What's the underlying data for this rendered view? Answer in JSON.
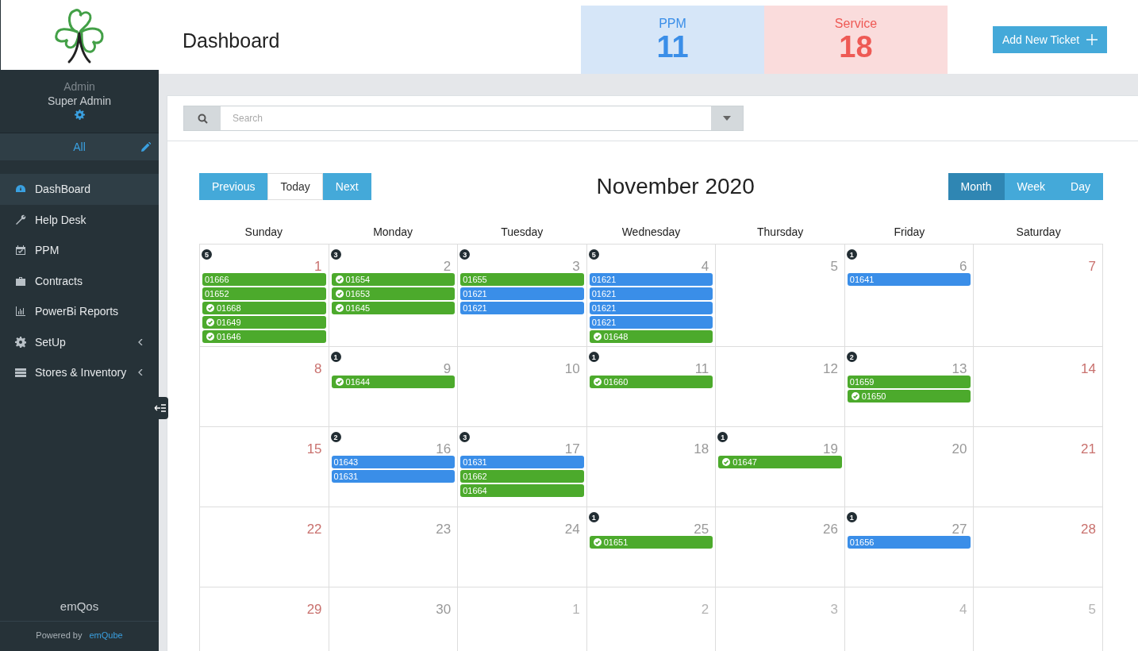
{
  "sidebar": {
    "user": {
      "name": "Admin",
      "role": "Super Admin"
    },
    "filter": {
      "label": "All"
    },
    "items": [
      {
        "label": "DashBoard",
        "selected": true,
        "submenu": false
      },
      {
        "label": "Help Desk",
        "selected": false,
        "submenu": false
      },
      {
        "label": "PPM",
        "selected": false,
        "submenu": false
      },
      {
        "label": "Contracts",
        "selected": false,
        "submenu": false
      },
      {
        "label": "PowerBi Reports",
        "selected": false,
        "submenu": false
      },
      {
        "label": "SetUp",
        "selected": false,
        "submenu": true
      },
      {
        "label": "Stores & Inventory",
        "selected": false,
        "submenu": true
      }
    ],
    "product": "emQos",
    "powered_by": {
      "label": "Powered by",
      "link": "emQube"
    }
  },
  "header": {
    "title": "Dashboard",
    "stats": [
      {
        "label": "PPM",
        "value": "11",
        "kind": "ppm"
      },
      {
        "label": "Service",
        "value": "18",
        "kind": "service"
      }
    ],
    "add_button": "Add New Ticket"
  },
  "search": {
    "placeholder": "Search"
  },
  "calendar": {
    "title": "November 2020",
    "nav": [
      {
        "label": "Previous",
        "selected": false
      },
      {
        "label": "Today",
        "selected": true
      },
      {
        "label": "Next",
        "selected": false
      }
    ],
    "views": [
      {
        "label": "Month",
        "selected": true
      },
      {
        "label": "Week",
        "selected": false
      },
      {
        "label": "Day",
        "selected": false
      }
    ],
    "weekdays": [
      "Sunday",
      "Monday",
      "Tuesday",
      "Wednesday",
      "Thursday",
      "Friday",
      "Saturday"
    ],
    "weeks": [
      [
        {
          "day": "1",
          "kind": "weekend",
          "badge": "5",
          "events": [
            {
              "id": "01666",
              "color": "#4caa2c",
              "done": false
            },
            {
              "id": "01652",
              "color": "#4caa2c",
              "done": false
            },
            {
              "id": "01668",
              "color": "#4caa2c",
              "done": true
            },
            {
              "id": "01649",
              "color": "#4caa2c",
              "done": true
            },
            {
              "id": "01646",
              "color": "#4caa2c",
              "done": true
            }
          ]
        },
        {
          "day": "2",
          "kind": "weekday",
          "badge": "3",
          "events": [
            {
              "id": "01654",
              "color": "#4caa2c",
              "done": true
            },
            {
              "id": "01653",
              "color": "#4caa2c",
              "done": true
            },
            {
              "id": "01645",
              "color": "#4caa2c",
              "done": true
            }
          ]
        },
        {
          "day": "3",
          "kind": "weekday",
          "badge": "3",
          "events": [
            {
              "id": "01655",
              "color": "#4caa2c",
              "done": false
            },
            {
              "id": "01621",
              "color": "#3a8ee8",
              "done": false
            },
            {
              "id": "01621",
              "color": "#3a8ee8",
              "done": false
            }
          ]
        },
        {
          "day": "4",
          "kind": "weekday",
          "badge": "5",
          "events": [
            {
              "id": "01621",
              "color": "#3a8ee8",
              "done": false
            },
            {
              "id": "01621",
              "color": "#3a8ee8",
              "done": false
            },
            {
              "id": "01621",
              "color": "#3a8ee8",
              "done": false
            },
            {
              "id": "01621",
              "color": "#3a8ee8",
              "done": false
            },
            {
              "id": "01648",
              "color": "#4caa2c",
              "done": true
            }
          ]
        },
        {
          "day": "5",
          "kind": "weekday"
        },
        {
          "day": "6",
          "kind": "weekday",
          "badge": "1",
          "events": [
            {
              "id": "01641",
              "color": "#3a8ee8",
              "done": false
            }
          ]
        },
        {
          "day": "7",
          "kind": "weekend"
        }
      ],
      [
        {
          "day": "8",
          "kind": "weekend"
        },
        {
          "day": "9",
          "kind": "weekday",
          "badge": "1",
          "events": [
            {
              "id": "01644",
              "color": "#4caa2c",
              "done": true
            }
          ]
        },
        {
          "day": "10",
          "kind": "weekday"
        },
        {
          "day": "11",
          "kind": "weekday",
          "badge": "1",
          "events": [
            {
              "id": "01660",
              "color": "#4caa2c",
              "done": true
            }
          ]
        },
        {
          "day": "12",
          "kind": "weekday"
        },
        {
          "day": "13",
          "kind": "weekday",
          "badge": "2",
          "events": [
            {
              "id": "01659",
              "color": "#4caa2c",
              "done": false
            },
            {
              "id": "01650",
              "color": "#4caa2c",
              "done": true
            }
          ]
        },
        {
          "day": "14",
          "kind": "weekend"
        }
      ],
      [
        {
          "day": "15",
          "kind": "weekend"
        },
        {
          "day": "16",
          "kind": "weekday",
          "badge": "2",
          "events": [
            {
              "id": "01643",
              "color": "#3a8ee8",
              "done": false
            },
            {
              "id": "01631",
              "color": "#3a8ee8",
              "done": false
            }
          ]
        },
        {
          "day": "17",
          "kind": "weekday",
          "badge": "3",
          "events": [
            {
              "id": "01631",
              "color": "#3a8ee8",
              "done": false
            },
            {
              "id": "01662",
              "color": "#4caa2c",
              "done": false
            },
            {
              "id": "01664",
              "color": "#4caa2c",
              "done": false
            }
          ]
        },
        {
          "day": "18",
          "kind": "weekday"
        },
        {
          "day": "19",
          "kind": "weekday",
          "badge": "1",
          "events": [
            {
              "id": "01647",
              "color": "#4caa2c",
              "done": true
            }
          ]
        },
        {
          "day": "20",
          "kind": "weekday"
        },
        {
          "day": "21",
          "kind": "weekend"
        }
      ],
      [
        {
          "day": "22",
          "kind": "weekend"
        },
        {
          "day": "23",
          "kind": "weekday"
        },
        {
          "day": "24",
          "kind": "weekday"
        },
        {
          "day": "25",
          "kind": "weekday",
          "badge": "1",
          "events": [
            {
              "id": "01651",
              "color": "#4caa2c",
              "done": true
            }
          ]
        },
        {
          "day": "26",
          "kind": "weekday"
        },
        {
          "day": "27",
          "kind": "weekday",
          "badge": "1",
          "events": [
            {
              "id": "01656",
              "color": "#3a8ee8",
              "done": false
            }
          ]
        },
        {
          "day": "28",
          "kind": "weekend"
        }
      ],
      [
        {
          "day": "29",
          "kind": "weekend"
        },
        {
          "day": "30",
          "kind": "weekday"
        },
        {
          "day": "1",
          "kind": "outside"
        },
        {
          "day": "2",
          "kind": "outside"
        },
        {
          "day": "3",
          "kind": "outside"
        },
        {
          "day": "4",
          "kind": "outside"
        },
        {
          "day": "5",
          "kind": "outside"
        }
      ]
    ]
  }
}
